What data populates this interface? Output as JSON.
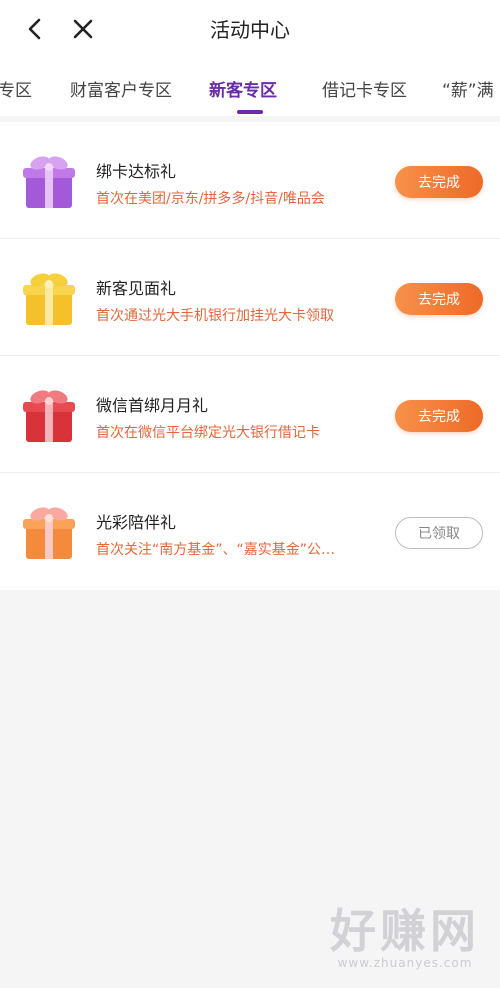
{
  "header": {
    "title": "活动中心",
    "back_icon": "chevron-left-icon",
    "close_icon": "close-icon"
  },
  "tabs": [
    {
      "label": "专区",
      "active": false
    },
    {
      "label": "财富客户专区",
      "active": false
    },
    {
      "label": "新客专区",
      "active": true
    },
    {
      "label": "借记卡专区",
      "active": false
    },
    {
      "label": "“薪”满",
      "active": false
    }
  ],
  "colors": {
    "accent": "#6a2ca8",
    "desc": "#e2673a",
    "button_start": "#f7914a",
    "button_end": "#ee6a28"
  },
  "items": [
    {
      "title": "绑卡达标礼",
      "desc": "首次在美团/京东/拼多多/抖音/唯品会",
      "button": "去完成",
      "status": "pending",
      "icon": "gift-purple-icon"
    },
    {
      "title": "新客见面礼",
      "desc": "首次通过光大手机银行加挂光大卡领取",
      "button": "去完成",
      "status": "pending",
      "icon": "gift-yellow-icon"
    },
    {
      "title": "微信首绑月月礼",
      "desc": "首次在微信平台绑定光大银行借记卡",
      "button": "去完成",
      "status": "pending",
      "icon": "gift-red-icon"
    },
    {
      "title": "光彩陪伴礼",
      "desc": "首次关注“南方基金”、“嘉实基金”公众号",
      "button": "已领取",
      "status": "claimed",
      "icon": "gift-orange-icon"
    }
  ],
  "watermark": {
    "text": "好赚网",
    "url": "www.zhuanyes.com"
  }
}
